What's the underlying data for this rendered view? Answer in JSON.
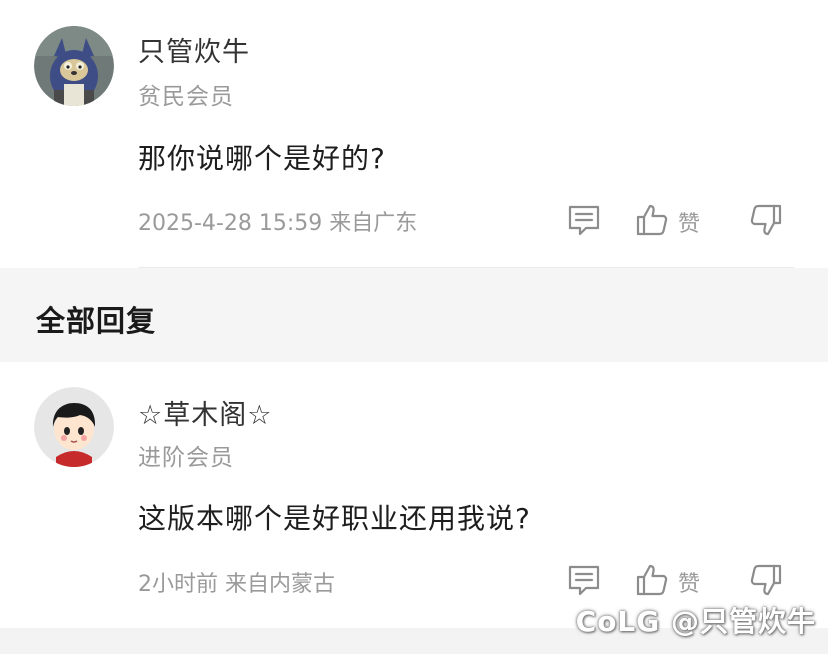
{
  "top_comment": {
    "username": "只管炊牛",
    "level": "贫民会员",
    "text": "那你说哪个是好的?",
    "meta": "2025-4-28 15:59  来自广东",
    "like_label": "赞",
    "avatar_icon": "cartoon-cat-avatar"
  },
  "section": {
    "title": "全部回复"
  },
  "replies": [
    {
      "username": "☆草木阁☆",
      "level": "进阶会员",
      "text": "这版本哪个是好职业还用我说?",
      "meta": "2小时前  来自内蒙古",
      "like_label": "赞",
      "avatar_icon": "cartoon-kid-avatar"
    }
  ],
  "watermark": {
    "text": "CoLG @只管炊牛"
  },
  "colors": {
    "secondary_text": "#9a9a9a",
    "section_bg": "#f5f5f5",
    "icon_stroke": "#8c8c8c"
  }
}
